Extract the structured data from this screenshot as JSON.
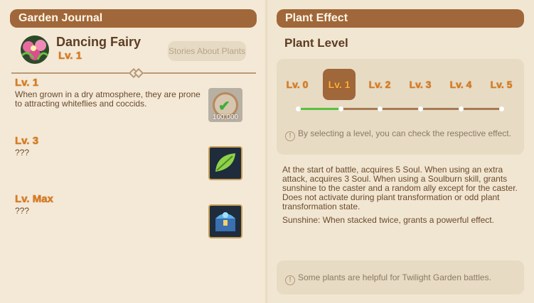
{
  "left": {
    "header": "Garden Journal",
    "plant": {
      "name": "Dancing Fairy",
      "level": "Lv. 1"
    },
    "stories_button": "Stories About Plants",
    "levels": [
      {
        "title": "Lv. 1",
        "desc": "When grown in a dry atmosphere, they are prone to attracting whiteflies and coccids.",
        "reward_count": "100,000"
      },
      {
        "title": "Lv. 3",
        "desc": "???"
      },
      {
        "title": "Lv. Max",
        "desc": "???"
      }
    ]
  },
  "right": {
    "header": "Plant Effect",
    "section_title": "Plant Level",
    "tabs": [
      "Lv. 0",
      "Lv. 1",
      "Lv. 2",
      "Lv. 3",
      "Lv. 4",
      "Lv. 5"
    ],
    "selected_tab": "Lv. 1",
    "level_hint": "By selecting a level, you can check the respective effect.",
    "effect": "At the start of battle, acquires 5 Soul. When using an extra attack, acquires 3 Soul. When using a Soulburn skill, grants sunshine to the caster and a random ally except for the caster. Does not activate during plant transformation or odd plant transformation state.",
    "sunshine": "Sunshine: When stacked twice, grants a powerful effect.",
    "tip": "Some plants are helpful for Twilight Garden battles."
  },
  "colors": {
    "header": "#a0673a",
    "level_orange": "#e07a18",
    "progress_green": "#5ac23e"
  }
}
